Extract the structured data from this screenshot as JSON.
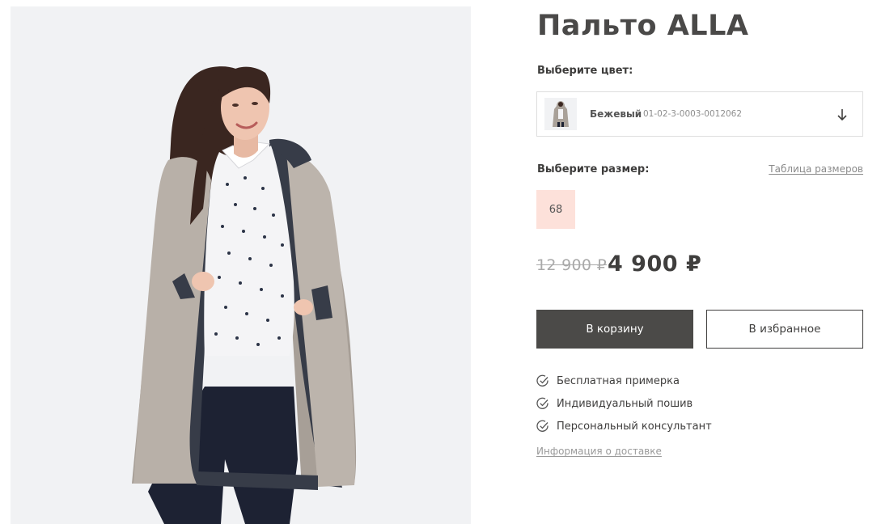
{
  "product": {
    "title": "Пальто ALLA",
    "image_alt": "coat-model-photo"
  },
  "color": {
    "label": "Выберите цвет:",
    "selected_name": "Бежевый",
    "selected_sku": "01-02-3-0003-0012062",
    "icon": "arrow-down-icon"
  },
  "size": {
    "label": "Выберите размер:",
    "table_link": "Таблица размеров",
    "options": [
      "68"
    ],
    "chip_color": "#fde1da"
  },
  "price": {
    "old": "12 900 ₽",
    "current": "4 900 ₽"
  },
  "actions": {
    "cart": "В корзину",
    "favorite": "В избранное",
    "cart_color": "#4b4a48"
  },
  "features": [
    "Бесплатная примерка",
    "Индивидуальный пошив",
    "Персональный консультант"
  ],
  "delivery_link": "Информация о доставке"
}
